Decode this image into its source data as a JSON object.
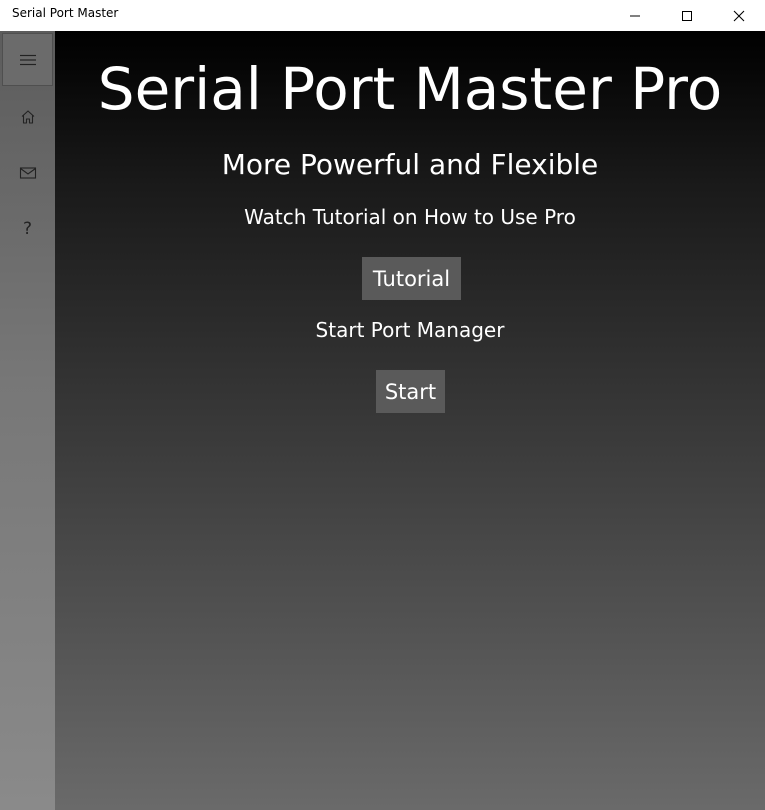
{
  "window": {
    "title": "Serial Port Master"
  },
  "titlebar_buttons": {
    "minimize_icon": "minimize-icon",
    "maximize_icon": "maximize-icon",
    "close_icon": "close-icon"
  },
  "sidebar": {
    "items": [
      {
        "id": "menu",
        "icon": "hamburger-icon"
      },
      {
        "id": "home",
        "icon": "home-icon"
      },
      {
        "id": "mail",
        "icon": "mail-icon"
      },
      {
        "id": "help",
        "icon": "help-icon",
        "glyph": "?"
      }
    ]
  },
  "main": {
    "title": "Serial Port Master Pro",
    "subtitle": "More Powerful and Flexible",
    "tutorial_label": "Watch Tutorial on How to Use Pro",
    "tutorial_button": "Tutorial",
    "start_label": "Start Port Manager",
    "start_button": "Start"
  },
  "colors": {
    "content_gradient_top": "#000000",
    "content_gradient_bottom": "#6a6a6a",
    "sidebar_bg": "#777777",
    "button_bg": "#5a5a5a",
    "text": "#ffffff"
  }
}
